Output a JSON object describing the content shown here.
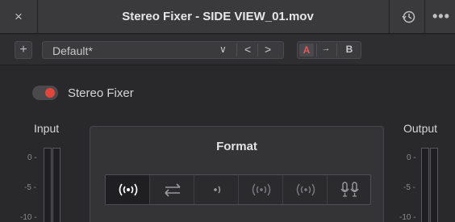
{
  "window": {
    "close_glyph": "×",
    "title": "Stereo Fixer - SIDE VIEW_01.mov",
    "history_icon": "history-icon",
    "more_glyph": "•••"
  },
  "toolbar": {
    "add_glyph": "+",
    "preset_name": "Default*",
    "chevron_glyph": "∨",
    "prev_glyph": "<",
    "next_glyph": ">",
    "compare_a": "A",
    "compare_arrow": "→",
    "compare_b": "B"
  },
  "bypass": {
    "label": "Stereo Fixer",
    "enabled": true,
    "accent": "#e3453b"
  },
  "input_meter": {
    "title": "Input",
    "ticks": [
      "0 -",
      "-5 -",
      "-10 -"
    ]
  },
  "output_meter": {
    "title": "Output",
    "ticks": [
      "0 -",
      "-5 -",
      "-10 -"
    ]
  },
  "format": {
    "title": "Format",
    "options": [
      {
        "icon": "stereo-icon",
        "selected": true
      },
      {
        "icon": "swap-channels-icon",
        "selected": false
      },
      {
        "icon": "right-only-icon",
        "selected": false
      },
      {
        "icon": "left-right-dim-icon",
        "selected": false
      },
      {
        "icon": "mono-sum-icon",
        "selected": false
      },
      {
        "icon": "dual-mic-icon",
        "selected": false
      }
    ]
  }
}
